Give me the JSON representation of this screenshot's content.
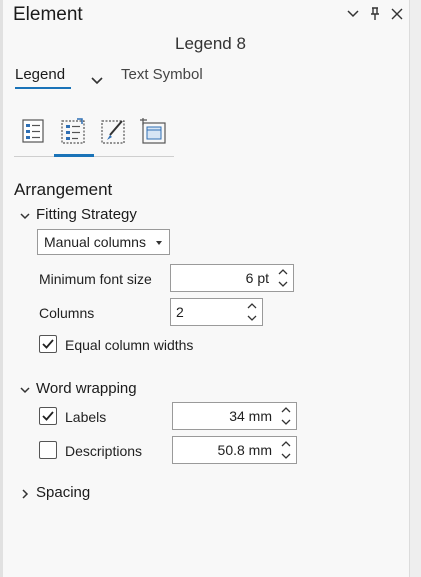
{
  "window": {
    "title": "Element",
    "element_name": "Legend 8"
  },
  "tabs": [
    {
      "label": "Legend",
      "active": true
    },
    {
      "label": "Text Symbol",
      "active": false
    }
  ],
  "icon_tabs": [
    {
      "name": "legend-options-icon",
      "active": false
    },
    {
      "name": "arrangement-icon",
      "active": true
    },
    {
      "name": "display-brush-icon",
      "active": false
    },
    {
      "name": "placement-frame-icon",
      "active": false
    }
  ],
  "arrangement": {
    "title": "Arrangement",
    "fitting_strategy": {
      "header": "Fitting Strategy",
      "expanded": true,
      "strategy_value": "Manual columns",
      "min_font_label": "Minimum font size",
      "min_font_value": "6 pt",
      "columns_label": "Columns",
      "columns_value": "2",
      "equal_widths_label": "Equal column widths",
      "equal_widths_checked": true
    },
    "word_wrapping": {
      "header": "Word wrapping",
      "expanded": true,
      "labels_label": "Labels",
      "labels_checked": true,
      "labels_value": "34 mm",
      "descriptions_label": "Descriptions",
      "descriptions_checked": false,
      "descriptions_value": "50.8 mm"
    },
    "spacing": {
      "header": "Spacing",
      "expanded": false
    }
  },
  "colors": {
    "accent": "#1a73b8",
    "icon_blue": "#2f6fb4"
  }
}
